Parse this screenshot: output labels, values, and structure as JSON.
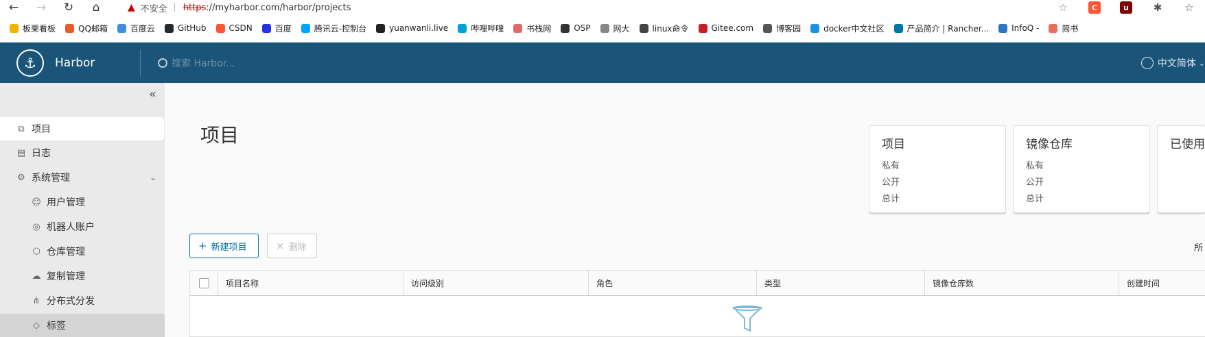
{
  "browser": {
    "insecure_label": "不安全",
    "url_scheme": "https",
    "url_rest": "://myharbor.com/harbor/projects"
  },
  "bookmarks": [
    {
      "label": "板栗看板",
      "color": "#f0b400"
    },
    {
      "label": "QQ邮箱",
      "color": "#e95b2a"
    },
    {
      "label": "百度云",
      "color": "#3d8de0"
    },
    {
      "label": "GitHub",
      "color": "#24292e"
    },
    {
      "label": "CSDN",
      "color": "#fc5531"
    },
    {
      "label": "百度",
      "color": "#2932e1"
    },
    {
      "label": "腾讯云-控制台",
      "color": "#00a3ff"
    },
    {
      "label": "yuanwanli.live",
      "color": "#222222"
    },
    {
      "label": "哔哩哔哩",
      "color": "#00a1d6"
    },
    {
      "label": "书栈网",
      "color": "#e06a6a"
    },
    {
      "label": "OSP",
      "color": "#333333"
    },
    {
      "label": "网大",
      "color": "#888888"
    },
    {
      "label": "linux命令",
      "color": "#444444"
    },
    {
      "label": "Gitee.com",
      "color": "#c71d23"
    },
    {
      "label": "博客园",
      "color": "#555555"
    },
    {
      "label": "docker中文社区",
      "color": "#1d91e6"
    },
    {
      "label": "产品简介 | Rancher...",
      "color": "#0075a8"
    },
    {
      "label": "InfoQ -",
      "color": "#2d75c4"
    },
    {
      "label": "简书",
      "color": "#ea6f5a"
    }
  ],
  "header": {
    "brand": "Harbor",
    "search_placeholder": "搜索 Harbor...",
    "language": "中文简体"
  },
  "sidebar": {
    "items": [
      {
        "label": "项目",
        "icon": "projects-icon"
      },
      {
        "label": "日志",
        "icon": "logs-icon"
      },
      {
        "label": "系统管理",
        "icon": "admin-icon"
      },
      {
        "label": "用户管理",
        "icon": "users-icon"
      },
      {
        "label": "机器人账户",
        "icon": "robot-icon"
      },
      {
        "label": "仓库管理",
        "icon": "registry-icon"
      },
      {
        "label": "复制管理",
        "icon": "replication-icon"
      },
      {
        "label": "分布式分发",
        "icon": "distribution-icon"
      },
      {
        "label": "标签",
        "icon": "tag-icon"
      }
    ]
  },
  "main": {
    "title": "项目",
    "cards": [
      {
        "title": "项目",
        "rows": [
          "私有",
          "公开",
          "总计"
        ]
      },
      {
        "title": "镜像仓库",
        "rows": [
          "私有",
          "公开",
          "总计"
        ]
      },
      {
        "title": "已使用",
        "rows": []
      }
    ],
    "new_button": "新建项目",
    "delete_button": "删除",
    "filter_label": "所",
    "table": {
      "columns": [
        "项目名称",
        "访问级别",
        "角色",
        "类型",
        "镜像仓库数",
        "创建时间"
      ]
    }
  }
}
